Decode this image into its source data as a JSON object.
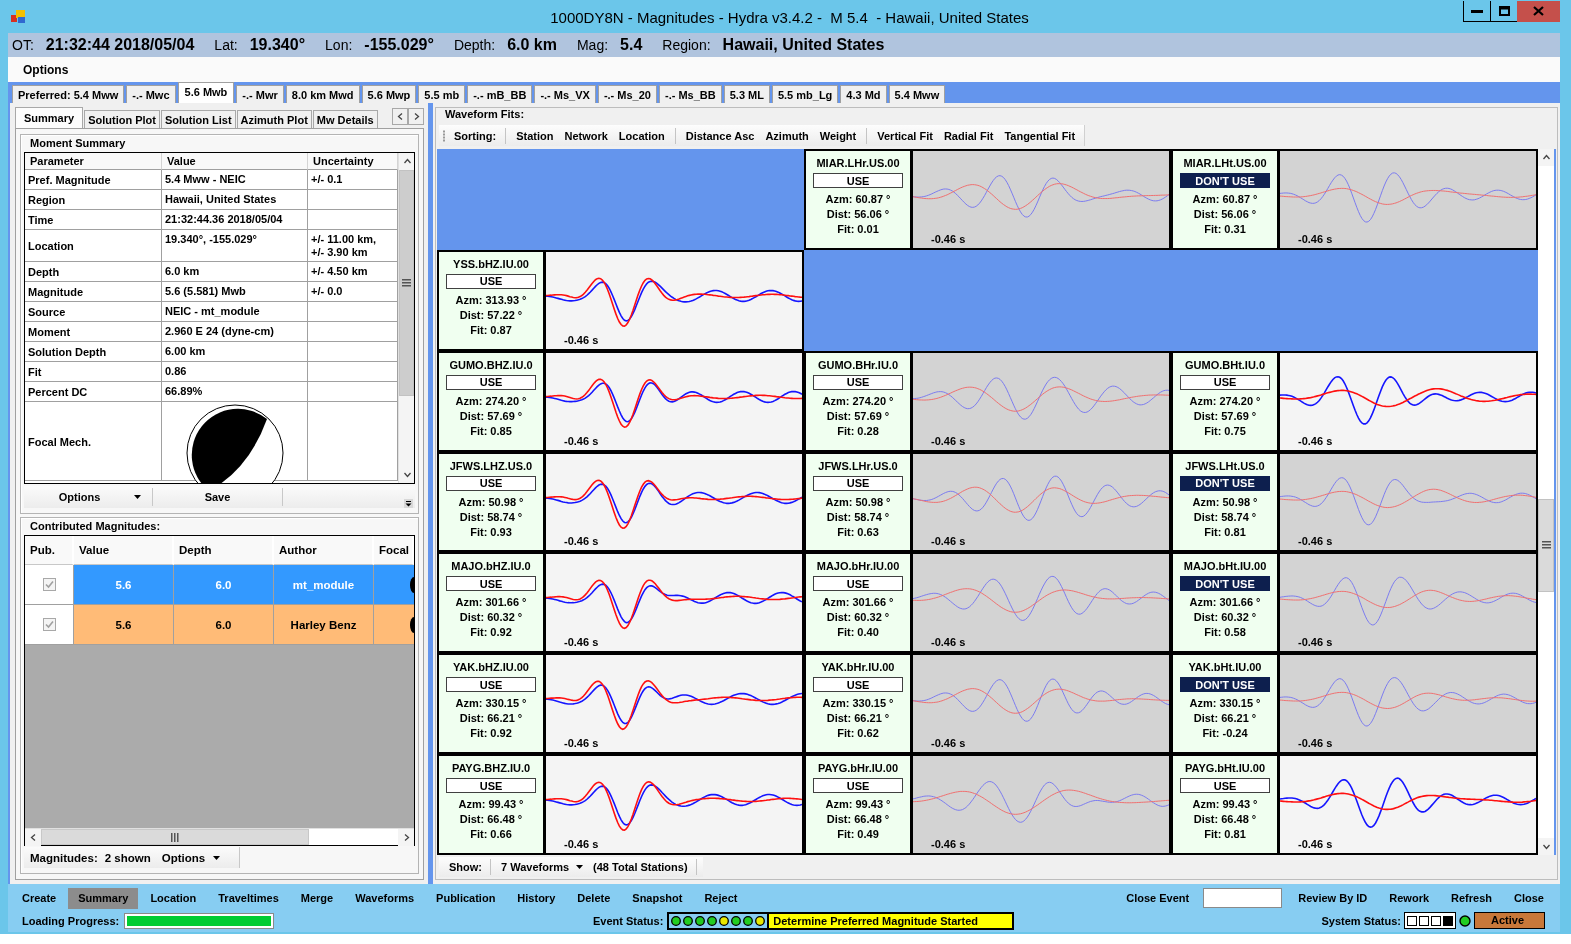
{
  "window": {
    "title": "1000DY8N - Magnitudes - Hydra v3.4.2 -  M 5.4  - Hawaii, United States"
  },
  "event_info": [
    {
      "label": "OT:",
      "value": "21:32:44 2018/05/04"
    },
    {
      "label": "Lat:",
      "value": "19.340°"
    },
    {
      "label": "Lon:",
      "value": "-155.029°"
    },
    {
      "label": "Depth:",
      "value": "6.0 km"
    },
    {
      "label": "Mag:",
      "value": "5.4"
    },
    {
      "label": "Region:",
      "value": "Hawaii, United States"
    }
  ],
  "menu": [
    {
      "label": "Options"
    }
  ],
  "magnitude_tabs": [
    {
      "label": "Preferred: 5.4 Mww",
      "selected": false
    },
    {
      "label": "-.- Mwc",
      "selected": false
    },
    {
      "label": "5.6 Mwb",
      "selected": true
    },
    {
      "label": "-.- Mwr",
      "selected": false
    },
    {
      "label": "8.0 km Mwd",
      "selected": false
    },
    {
      "label": "5.6 Mwp",
      "selected": false
    },
    {
      "label": "5.5 mb",
      "selected": false
    },
    {
      "label": "-.- mB_BB",
      "selected": false
    },
    {
      "label": "-.- Ms_VX",
      "selected": false
    },
    {
      "label": "-.- Ms_20",
      "selected": false
    },
    {
      "label": "-.- Ms_BB",
      "selected": false
    },
    {
      "label": "5.3 ML",
      "selected": false
    },
    {
      "label": "5.5 mb_Lg",
      "selected": false
    },
    {
      "label": "4.3 Md",
      "selected": false
    },
    {
      "label": "5.4 Mww",
      "selected": false
    }
  ],
  "summary_panel": {
    "tabs": [
      {
        "label": "Summary",
        "selected": true
      },
      {
        "label": "Solution Plot",
        "selected": false
      },
      {
        "label": "Solution List",
        "selected": false
      },
      {
        "label": "Azimuth Plot",
        "selected": false
      },
      {
        "label": "Mw Details",
        "selected": false
      }
    ],
    "moment_summary": {
      "title": "Moment Summary",
      "columns": [
        "Parameter",
        "Value",
        "Uncertainty"
      ],
      "rows": [
        {
          "kind": "text",
          "parameter": "Pref. Magnitude",
          "value": "5.4 Mww - NEIC",
          "uncertainty": "+/- 0.1"
        },
        {
          "kind": "text",
          "parameter": "Region",
          "value": "Hawaii, United States"
        },
        {
          "kind": "text",
          "parameter": "Time",
          "value": "21:32:44.36 2018/05/04"
        },
        {
          "kind": "text",
          "parameter": "Location",
          "value": "19.340°, -155.029°",
          "uncertainty": "+/- 11.00 km, +/- 3.90 km"
        },
        {
          "kind": "text",
          "parameter": "Depth",
          "value": "6.0 km",
          "uncertainty": "+/- 4.50 km"
        },
        {
          "kind": "text",
          "parameter": "Magnitude",
          "value": "5.6 (5.581) Mwb",
          "uncertainty": "+/- 0.0"
        },
        {
          "kind": "text",
          "parameter": "Source",
          "value": "NEIC - mt_module"
        },
        {
          "kind": "text",
          "parameter": "Moment",
          "value": "2.960 E 24 (dyne-cm)"
        },
        {
          "kind": "text",
          "parameter": "Solution Depth",
          "value": "6.00 km"
        },
        {
          "kind": "text",
          "parameter": "Fit",
          "value": "0.86"
        },
        {
          "kind": "text",
          "parameter": "Percent DC",
          "value": "66.89%"
        },
        {
          "kind": "beachball",
          "parameter": "Focal Mech."
        }
      ]
    },
    "toolbar": [
      {
        "kind": "dropdown",
        "label": "Options"
      },
      {
        "kind": "button",
        "label": "Save"
      }
    ]
  },
  "contributed_magnitudes": {
    "title": "Contributed Magnitudes:",
    "columns": [
      "Pub.",
      "Value",
      "Depth",
      "Author",
      "Focal"
    ],
    "rows": [
      {
        "published": true,
        "disabled": true,
        "selected": true,
        "value": "5.6",
        "depth": "6.0",
        "author": "mt_module"
      },
      {
        "published": true,
        "disabled": true,
        "selected": false,
        "color": "#ffbb77",
        "value": "5.6",
        "depth": "6.0",
        "author": "Harley Benz"
      }
    ],
    "footer": {
      "label": "Magnitudes:",
      "count": "2 shown",
      "options": "Options"
    }
  },
  "waveform_fits": {
    "title": "Waveform Fits:",
    "sorting_label": "Sorting:",
    "sort_groups": [
      [
        {
          "label": "Station"
        },
        {
          "label": "Network"
        },
        {
          "label": "Location"
        }
      ],
      [
        {
          "label": "Distance Asc"
        },
        {
          "label": "Azimuth"
        },
        {
          "label": "Weight"
        }
      ],
      [
        {
          "label": "Vertical Fit"
        },
        {
          "label": "Radial Fit"
        },
        {
          "label": "Tangential Fit"
        }
      ]
    ],
    "rows": [
      {
        "cells": [
          {
            "kind": "empty"
          },
          {
            "kind": "trace",
            "station": "MIAR.LHr.US.00",
            "button": "USE",
            "excluded": false,
            "azimuth": "Azm: 60.87 °",
            "distance": "Dist: 56.06 °",
            "fit": "Fit: 0.01",
            "shift": "-0.46 s",
            "dimmed": true
          },
          {
            "kind": "trace",
            "station": "MIAR.LHt.US.00",
            "button": "DON'T USE",
            "excluded": true,
            "azimuth": "Azm: 60.87 °",
            "distance": "Dist: 56.06 °",
            "fit": "Fit: 0.31",
            "shift": "-0.46 s",
            "dimmed": true
          }
        ]
      },
      {
        "cells": [
          {
            "kind": "trace",
            "station": "YSS.bHZ.IU.00",
            "button": "USE",
            "excluded": false,
            "azimuth": "Azm: 313.93 °",
            "distance": "Dist: 57.22 °",
            "fit": "Fit: 0.87",
            "shift": "-0.46 s",
            "dimmed": false
          },
          {
            "kind": "empty"
          },
          {
            "kind": "empty"
          }
        ]
      },
      {
        "cells": [
          {
            "kind": "trace",
            "station": "GUMO.BHZ.IU.0",
            "button": "USE",
            "excluded": false,
            "azimuth": "Azm: 274.20 °",
            "distance": "Dist: 57.69 °",
            "fit": "Fit: 0.85",
            "shift": "-0.46 s",
            "dimmed": false
          },
          {
            "kind": "trace",
            "station": "GUMO.BHr.IU.0",
            "button": "USE",
            "excluded": false,
            "azimuth": "Azm: 274.20 °",
            "distance": "Dist: 57.69 °",
            "fit": "Fit: 0.28",
            "shift": "-0.46 s",
            "dimmed": true
          },
          {
            "kind": "trace",
            "station": "GUMO.BHt.IU.0",
            "button": "USE",
            "excluded": false,
            "azimuth": "Azm: 274.20 °",
            "distance": "Dist: 57.69 °",
            "fit": "Fit: 0.75",
            "shift": "-0.46 s",
            "dimmed": false
          }
        ]
      },
      {
        "cells": [
          {
            "kind": "trace",
            "station": "JFWS.LHZ.US.0",
            "button": "USE",
            "excluded": false,
            "azimuth": "Azm: 50.98 °",
            "distance": "Dist: 58.74 °",
            "fit": "Fit: 0.93",
            "shift": "-0.46 s",
            "dimmed": false
          },
          {
            "kind": "trace",
            "station": "JFWS.LHr.US.0",
            "button": "USE",
            "excluded": false,
            "azimuth": "Azm: 50.98 °",
            "distance": "Dist: 58.74 °",
            "fit": "Fit: 0.63",
            "shift": "-0.46 s",
            "dimmed": true
          },
          {
            "kind": "trace",
            "station": "JFWS.LHt.US.0",
            "button": "DON'T USE",
            "excluded": true,
            "azimuth": "Azm: 50.98 °",
            "distance": "Dist: 58.74 °",
            "fit": "Fit: 0.81",
            "shift": "-0.46 s",
            "dimmed": true
          }
        ]
      },
      {
        "cells": [
          {
            "kind": "trace",
            "station": "MAJO.bHZ.IU.0",
            "button": "USE",
            "excluded": false,
            "azimuth": "Azm: 301.66 °",
            "distance": "Dist: 60.32 °",
            "fit": "Fit: 0.92",
            "shift": "-0.46 s",
            "dimmed": false
          },
          {
            "kind": "trace",
            "station": "MAJO.bHr.IU.00",
            "button": "USE",
            "excluded": false,
            "azimuth": "Azm: 301.66 °",
            "distance": "Dist: 60.32 °",
            "fit": "Fit: 0.40",
            "shift": "-0.46 s",
            "dimmed": true
          },
          {
            "kind": "trace",
            "station": "MAJO.bHt.IU.00",
            "button": "DON'T USE",
            "excluded": true,
            "azimuth": "Azm: 301.66 °",
            "distance": "Dist: 60.32 °",
            "fit": "Fit: 0.58",
            "shift": "-0.46 s",
            "dimmed": true
          }
        ]
      },
      {
        "cells": [
          {
            "kind": "trace",
            "station": "YAK.bHZ.IU.00",
            "button": "USE",
            "excluded": false,
            "azimuth": "Azm: 330.15 °",
            "distance": "Dist: 66.21 °",
            "fit": "Fit: 0.92",
            "shift": "-0.46 s",
            "dimmed": false
          },
          {
            "kind": "trace",
            "station": "YAK.bHr.IU.00",
            "button": "USE",
            "excluded": false,
            "azimuth": "Azm: 330.15 °",
            "distance": "Dist: 66.21 °",
            "fit": "Fit: 0.62",
            "shift": "-0.46 s",
            "dimmed": true
          },
          {
            "kind": "trace",
            "station": "YAK.bHt.IU.00",
            "button": "DON'T USE",
            "excluded": true,
            "azimuth": "Azm: 330.15 °",
            "distance": "Dist: 66.21 °",
            "fit": "Fit: -0.24",
            "shift": "-0.46 s",
            "dimmed": true
          }
        ]
      },
      {
        "cells": [
          {
            "kind": "trace",
            "station": "PAYG.BHZ.IU.0",
            "button": "USE",
            "excluded": false,
            "azimuth": "Azm: 99.43 °",
            "distance": "Dist: 66.48 °",
            "fit": "Fit: 0.66",
            "shift": "-0.46 s",
            "dimmed": false
          },
          {
            "kind": "trace",
            "station": "PAYG.bHr.IU.00",
            "button": "USE",
            "excluded": false,
            "azimuth": "Azm: 99.43 °",
            "distance": "Dist: 66.48 °",
            "fit": "Fit: 0.49",
            "shift": "-0.46 s",
            "dimmed": true
          },
          {
            "kind": "trace",
            "station": "PAYG.bHt.IU.00",
            "button": "USE",
            "excluded": false,
            "azimuth": "Azm: 99.43 °",
            "distance": "Dist: 66.48 °",
            "fit": "Fit: 0.81",
            "shift": "-0.46 s",
            "dimmed": false
          }
        ]
      }
    ],
    "footer": {
      "label": "Show:",
      "dropdown": "7 Waveforms",
      "total": "(48 Total Stations)"
    }
  },
  "actions": [
    {
      "label": "Create",
      "selected": false
    },
    {
      "label": "Summary",
      "selected": true
    },
    {
      "label": "Location",
      "selected": false
    },
    {
      "label": "Traveltimes",
      "selected": false
    },
    {
      "label": "Merge",
      "selected": false
    },
    {
      "label": "Waveforms",
      "selected": false
    },
    {
      "label": "Publication",
      "selected": false
    },
    {
      "label": "History",
      "selected": false
    },
    {
      "label": "Delete",
      "selected": false
    },
    {
      "label": "Snapshot",
      "selected": false
    },
    {
      "label": "Reject",
      "selected": false
    }
  ],
  "close_event": {
    "label": "Close Event"
  },
  "right_actions": [
    {
      "label": "Review By ID"
    },
    {
      "label": "Rework"
    },
    {
      "label": "Refresh"
    },
    {
      "label": "Close"
    }
  ],
  "status_bar": {
    "loading": {
      "label": "Loading Progress:",
      "level": 1
    },
    "event_status": {
      "label": "Event Status:",
      "lights": [
        {
          "color": "#22cc22"
        },
        {
          "color": "#22cc22"
        },
        {
          "color": "#22cc22"
        },
        {
          "color": "#22cc22"
        },
        {
          "color": "#e8e800"
        },
        {
          "color": "#22cc22"
        },
        {
          "color": "#22cc22"
        },
        {
          "color": "#e8e800"
        }
      ],
      "message": "Determine Preferred Magnitude Started"
    },
    "system_status": {
      "label": "System Status:",
      "indicators": [
        {
          "on": false
        },
        {
          "on": false
        },
        {
          "on": false
        },
        {
          "on": true
        }
      ],
      "lights": [
        {
          "color": "#22cc22"
        }
      ],
      "state": "Active"
    }
  }
}
